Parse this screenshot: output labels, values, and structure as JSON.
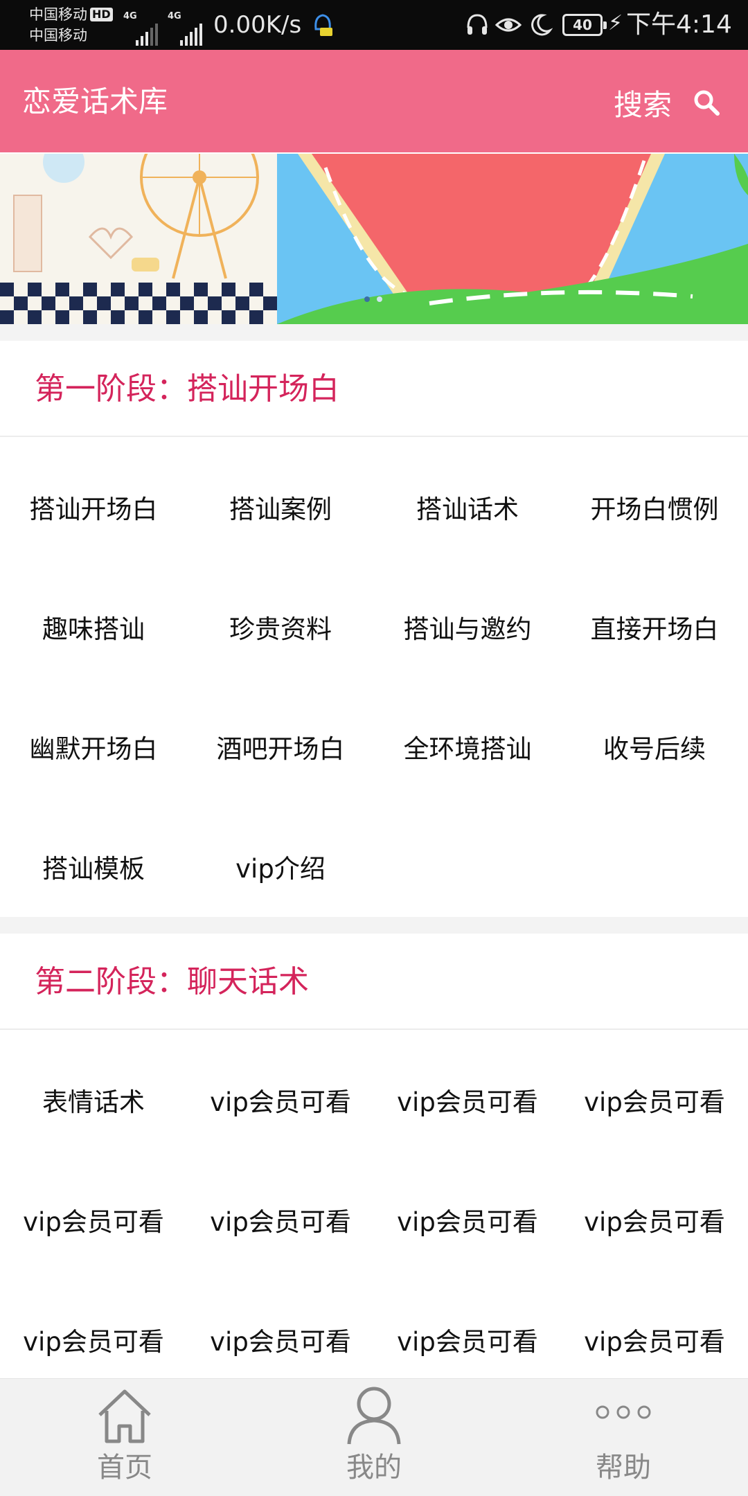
{
  "status_bar": {
    "carrier_1": "中国移动",
    "hd_badge": "HD",
    "carrier_2": "中国移动",
    "network_1": "4G",
    "network_2": "4G",
    "net_speed": "0.00K/s",
    "battery": "40",
    "time": "下午4:14"
  },
  "header": {
    "title": "恋爱话术库",
    "search_label": "搜索"
  },
  "section_1": {
    "title": "第一阶段：搭讪开场白",
    "items": [
      "搭讪开场白",
      "搭讪案例",
      "搭讪话术",
      "开场白惯例",
      "趣味搭讪",
      "珍贵资料",
      "搭讪与邀约",
      "直接开场白",
      "幽默开场白",
      "酒吧开场白",
      "全环境搭讪",
      "收号后续",
      "搭讪模板",
      "vip介绍"
    ]
  },
  "section_2": {
    "title": "第二阶段：聊天话术",
    "items": [
      "表情话术",
      "vip会员可看",
      "vip会员可看",
      "vip会员可看",
      "vip会员可看",
      "vip会员可看",
      "vip会员可看",
      "vip会员可看",
      "vip会员可看",
      "vip会员可看",
      "vip会员可看",
      "vip会员可看"
    ]
  },
  "bottom_nav": {
    "items": [
      {
        "label": "首页",
        "icon": "home-icon"
      },
      {
        "label": "我的",
        "icon": "user-icon"
      },
      {
        "label": "帮助",
        "icon": "more-icon"
      }
    ]
  },
  "colors": {
    "header_bg": "#f06a89",
    "section_title": "#d4245b",
    "status_bar_bg": "#0b0b0b",
    "nav_bg": "#f2f2f2"
  }
}
